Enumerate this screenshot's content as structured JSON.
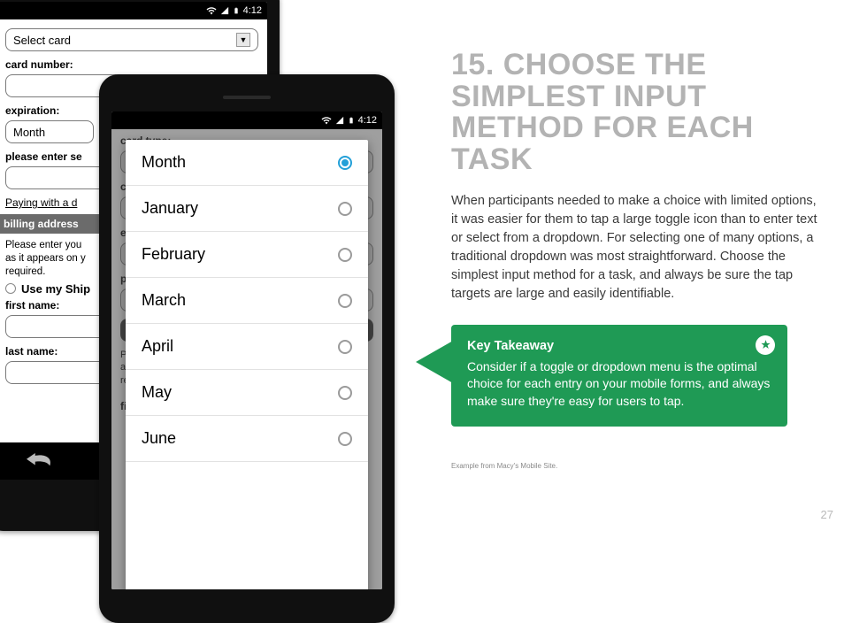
{
  "headline": "15. Choose the simplest input method for each task",
  "body": "When participants needed to make a choice with limited options, it was easier for them to tap a large toggle icon than to enter text or select from a dropdown. For selecting one of many options, a traditional dropdown was most straightforward. Choose the simplest input method for a task, and always be sure the tap targets are large and easily identifiable.",
  "takeaway": {
    "title": "Key Takeaway",
    "desc": "Consider if a toggle or dropdown menu is the optimal choice for each entry on your mobile forms, and always make sure they're easy for users to tap."
  },
  "caption": "Example from Macy's Mobile Site.",
  "page_number": "27",
  "status_time": "4:12",
  "back_form": {
    "select_card": "Select card",
    "card_number_label": "card number:",
    "expiration_label": "expiration:",
    "month_value": "Month",
    "security_label": "please enter se",
    "link": "Paying with a d",
    "billing_header": "billing address",
    "billing_hint_a": "Please enter you",
    "billing_hint_b": "as it appears on y",
    "billing_hint_c": "required.",
    "use_ship": "Use my Ship",
    "first_name": "first name:",
    "last_name": "last name:"
  },
  "front_form": {
    "card_type": "card type:",
    "left_edge": {
      "c": "c",
      "e": "e",
      "p": "p",
      "b": "B",
      "p2": "P",
      "a": "a",
      "r": "re",
      "fi": "fi"
    }
  },
  "modal": {
    "options": [
      "Month",
      "January",
      "February",
      "March",
      "April",
      "May",
      "June"
    ],
    "selected": "Month"
  }
}
